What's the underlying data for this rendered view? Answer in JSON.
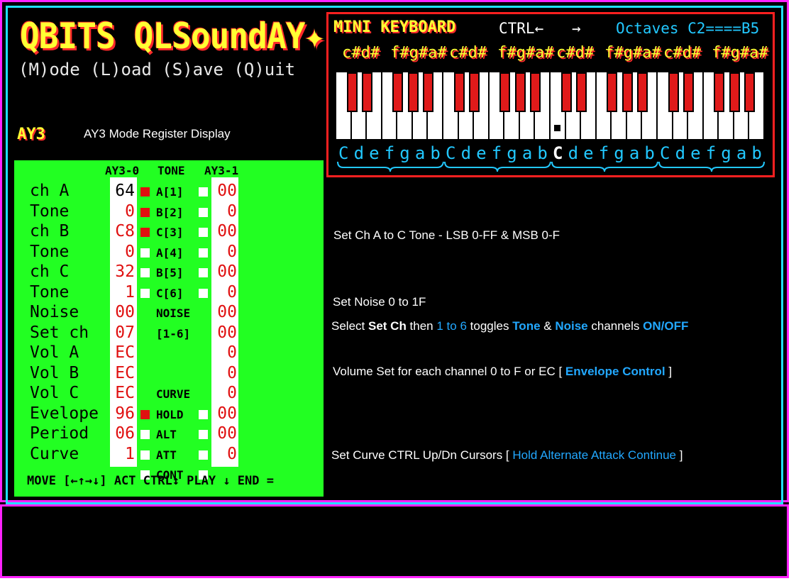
{
  "title": "QBITS QLSoundAY✦",
  "menu": "(M)ode (L)oad (S)ave (Q)uit",
  "mode_label": "AY3",
  "mode_description": "AY3 Mode Register Display",
  "keyboard": {
    "title": "MINI KEYBOARD",
    "ctrl": "CTRL←",
    "arrow": "→",
    "octaves": "Octaves C2====B5",
    "sharp_groups": [
      "c#d#",
      "f#g#a#",
      "c#d#",
      "f#g#a#",
      "c#d#",
      "f#g#a#",
      "c#d#",
      "f#g#a#"
    ],
    "naturals": [
      "C",
      "d",
      "e",
      "f",
      "g",
      "a",
      "b",
      "C",
      "d",
      "e",
      "f",
      "g",
      "a",
      "b",
      "C",
      "d",
      "e",
      "f",
      "g",
      "a",
      "b",
      "C",
      "d",
      "e",
      "f",
      "g",
      "a",
      "b"
    ]
  },
  "registers": {
    "headers": {
      "left": "AY3-0",
      "mid": "TONE",
      "right": "AY3-1"
    },
    "rows": [
      {
        "label": "ch A",
        "left": "64",
        "tone": "A[1]",
        "right": "00"
      },
      {
        "label": "Tone",
        "left": "0",
        "tone": "B[2]",
        "right": "0"
      },
      {
        "label": "ch B",
        "left": "C8",
        "tone": "C[3]",
        "right": "00"
      },
      {
        "label": "Tone",
        "left": "0",
        "tone": "A[4]",
        "right": "0"
      },
      {
        "label": "ch C",
        "left": "32",
        "tone": "B[5]",
        "right": "00"
      },
      {
        "label": "Tone",
        "left": "1",
        "tone": "C[6]",
        "right": "0"
      },
      {
        "label": "Noise",
        "left": "00",
        "tone": "NOISE",
        "right": "00"
      },
      {
        "label": "Set ch",
        "left": "07",
        "tone": "[1-6]",
        "right": "00"
      },
      {
        "label": "Vol A",
        "left": "EC",
        "tone": "",
        "right": "0"
      },
      {
        "label": "Vol B",
        "left": "EC",
        "tone": "",
        "right": "0"
      },
      {
        "label": "Vol C",
        "left": "EC",
        "tone": "CURVE",
        "right": "0"
      },
      {
        "label": "Evelope",
        "left": "96",
        "tone": "HOLD",
        "right": "00"
      },
      {
        "label": "Period",
        "left": "06",
        "tone": "ALT",
        "right": "00"
      },
      {
        "label": "Curve",
        "left": "1",
        "tone": "ATT",
        "right": "0"
      },
      {
        "label": "",
        "left": "",
        "tone": "CONT",
        "right": ""
      }
    ],
    "footer": "MOVE [←↑→↓] ACT CTRL↕ PLAY ↓ END ="
  },
  "info": {
    "line1": "Set Ch A to C Tone - LSB 0-FF & MSB 0-F",
    "line2": "Set Noise 0 to 1F",
    "line3": {
      "a": "Select ",
      "b": "Set Ch",
      "c": " then ",
      "d": "1 to 6",
      "e": " toggles ",
      "f": "Tone",
      "g": " & ",
      "h": "Noise",
      "i": " channels ",
      "j": "ON/OFF"
    },
    "line4": {
      "a": "Volume Set for each channel 0 to F or EC [ ",
      "b": "Envelope Control",
      "c": " ]"
    },
    "line5": {
      "a": "Set Curve CTRL Up/Dn Cursors [ ",
      "b": "Hold  Alternate  Attack  Continue",
      "c": " ]"
    }
  },
  "colors": {
    "border_magenta": "#ff22ff",
    "border_cyan": "#22e0ff",
    "panel_green": "#22ff22",
    "accent_red": "#e01010",
    "accent_blue": "#22a8ff",
    "title_yellow": "#ffff33"
  }
}
